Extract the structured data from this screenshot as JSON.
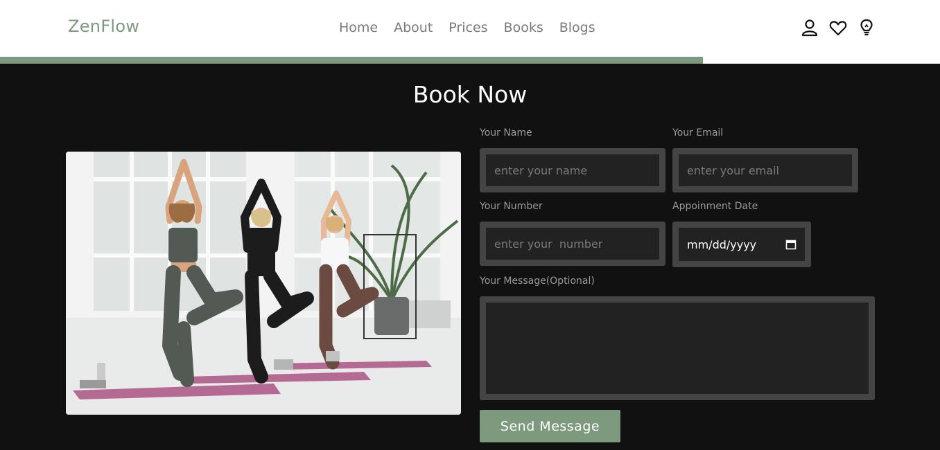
{
  "header": {
    "logo": "ZenFlow",
    "nav": [
      "Home",
      "About",
      "Prices",
      "Books",
      "Blogs"
    ],
    "icons": [
      "user-icon",
      "heart-icon",
      "lightbulb-icon"
    ],
    "scroll_progress_percent": 74.8
  },
  "booking": {
    "title": "Book Now",
    "image_alt": "three women doing tree pose yoga on mats in a bright studio",
    "name": {
      "label": "Your Name",
      "placeholder": "enter your name"
    },
    "email": {
      "label": "Your Email",
      "placeholder": "enter your email"
    },
    "number": {
      "label": "Your Number",
      "placeholder": "enter your  number"
    },
    "date": {
      "label": "Appoinment Date",
      "value": "mm/dd/yyyy"
    },
    "message": {
      "label": "Your Message(Optional)",
      "placeholder": ""
    },
    "submit_label": "Send Message"
  },
  "colors": {
    "accent": "#7d9a7f",
    "background": "#111111",
    "field_bg": "#222222",
    "field_border": "#444444"
  }
}
